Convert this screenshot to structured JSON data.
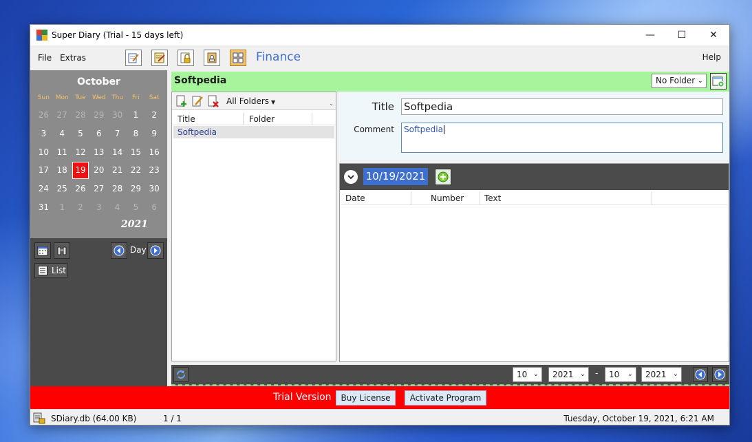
{
  "window": {
    "title": "Super Diary (Trial - 15 days left)",
    "minimize_glyph": "—",
    "maximize_glyph": "☐",
    "close_glyph": "✕"
  },
  "menu": {
    "file": "File",
    "extras": "Extras",
    "help": "Help",
    "module_title": "Finance"
  },
  "calendar": {
    "month": "October",
    "year": "2021",
    "weekdays": [
      "Sun",
      "Mon",
      "Tue",
      "Wed",
      "Thu",
      "Fri",
      "Sat"
    ],
    "days": [
      {
        "label": "26",
        "dim": true
      },
      {
        "label": "27",
        "dim": true
      },
      {
        "label": "28",
        "dim": true
      },
      {
        "label": "29",
        "dim": true
      },
      {
        "label": "30",
        "dim": true
      },
      {
        "label": "1",
        "dim": false
      },
      {
        "label": "2",
        "dim": false
      },
      {
        "label": "3",
        "dim": false
      },
      {
        "label": "4",
        "dim": false
      },
      {
        "label": "5",
        "dim": false
      },
      {
        "label": "6",
        "dim": false
      },
      {
        "label": "7",
        "dim": false
      },
      {
        "label": "8",
        "dim": false
      },
      {
        "label": "9",
        "dim": false
      },
      {
        "label": "10",
        "dim": false
      },
      {
        "label": "11",
        "dim": false
      },
      {
        "label": "12",
        "dim": false
      },
      {
        "label": "13",
        "dim": false
      },
      {
        "label": "14",
        "dim": false
      },
      {
        "label": "15",
        "dim": false
      },
      {
        "label": "16",
        "dim": false
      },
      {
        "label": "17",
        "dim": false
      },
      {
        "label": "18",
        "dim": false
      },
      {
        "label": "19",
        "dim": false,
        "today": true
      },
      {
        "label": "20",
        "dim": false
      },
      {
        "label": "21",
        "dim": false
      },
      {
        "label": "22",
        "dim": false
      },
      {
        "label": "23",
        "dim": false
      },
      {
        "label": "24",
        "dim": false
      },
      {
        "label": "25",
        "dim": false
      },
      {
        "label": "26",
        "dim": false
      },
      {
        "label": "27",
        "dim": false
      },
      {
        "label": "28",
        "dim": false
      },
      {
        "label": "29",
        "dim": false
      },
      {
        "label": "30",
        "dim": false
      },
      {
        "label": "31",
        "dim": false
      },
      {
        "label": "1",
        "dim": true
      },
      {
        "label": "2",
        "dim": true
      },
      {
        "label": "3",
        "dim": true
      },
      {
        "label": "4",
        "dim": true
      },
      {
        "label": "5",
        "dim": true
      },
      {
        "label": "6",
        "dim": true
      }
    ],
    "view_label": "Day",
    "list_label": "List"
  },
  "entry": {
    "header_title": "Softpedia",
    "folder_select": "No Folder",
    "list_filter": "All Folders",
    "columns": [
      "Title",
      "Folder"
    ],
    "rows": [
      {
        "title": "Softpedia",
        "folder": ""
      }
    ],
    "title_label": "Title",
    "title_value": "Softpedia",
    "comment_label": "Comment",
    "comment_value": "Softpedia"
  },
  "dates": {
    "current_date": "10/19/2021",
    "columns": [
      "Date",
      "Number",
      "Text"
    ]
  },
  "range": {
    "from_month": "10",
    "from_year": "2021",
    "dash": "-",
    "to_month": "10",
    "to_year": "2021"
  },
  "trial": {
    "text": "Trial Version",
    "buy_label": "Buy License",
    "activate_label": "Activate Program"
  },
  "status": {
    "db": "SDiary.db (64.00 KB)",
    "page": "1 / 1",
    "datetime": "Tuesday, October 19, 2021, 6:21 AM"
  },
  "colors": {
    "accent_blue": "#3f6fce",
    "header_green": "#a6f49c",
    "trial_red": "#ff0000",
    "today_red": "#ee1111",
    "weekday_orange": "#f2c26b"
  }
}
